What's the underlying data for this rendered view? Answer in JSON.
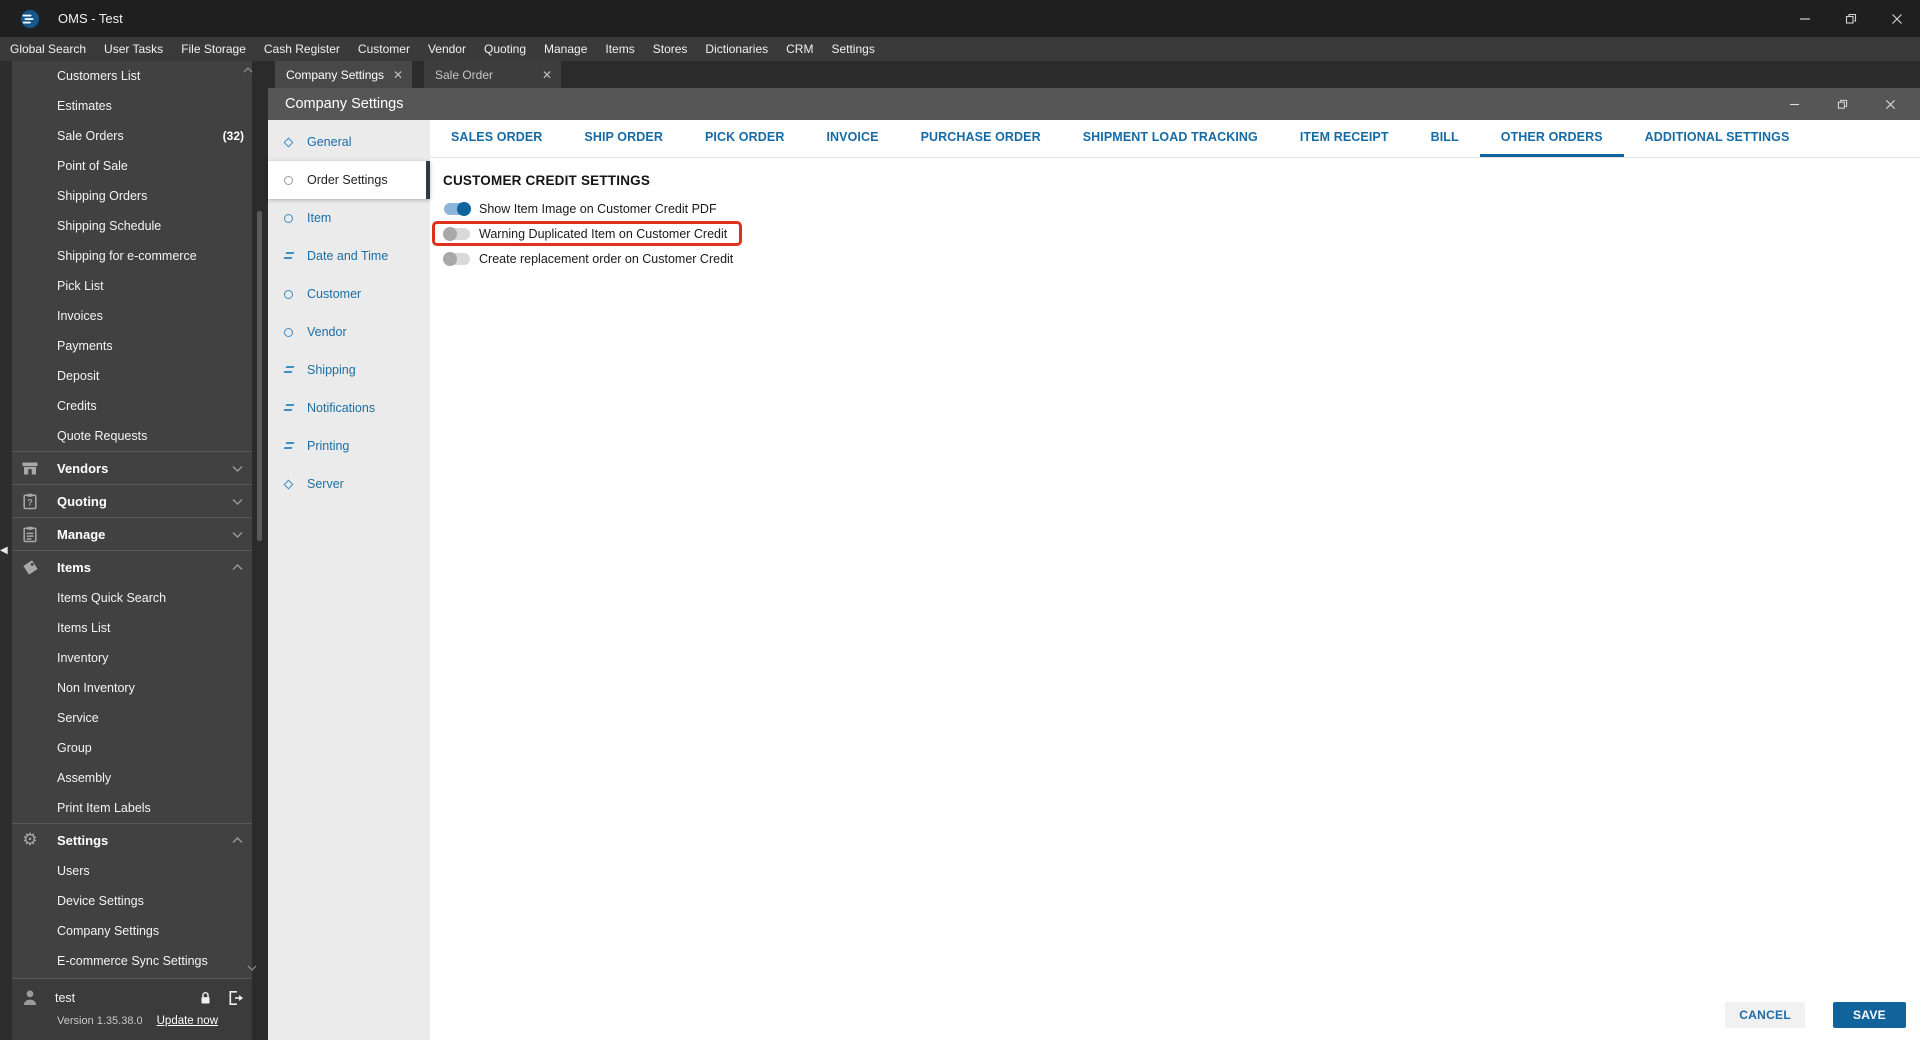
{
  "app": {
    "title": "OMS - Test"
  },
  "menubar": [
    "Global Search",
    "User Tasks",
    "File Storage",
    "Cash Register",
    "Customer",
    "Vendor",
    "Quoting",
    "Manage",
    "Items",
    "Stores",
    "Dictionaries",
    "CRM",
    "Settings"
  ],
  "sidebar": {
    "top_items": [
      {
        "label": "Customers List"
      },
      {
        "label": "Estimates"
      },
      {
        "label": "Sale Orders",
        "badge": "(32)"
      },
      {
        "label": "Point of Sale"
      },
      {
        "label": "Shipping Orders"
      },
      {
        "label": "Shipping Schedule"
      },
      {
        "label": "Shipping for e-commerce"
      },
      {
        "label": "Pick List"
      },
      {
        "label": "Invoices"
      },
      {
        "label": "Payments"
      },
      {
        "label": "Deposit"
      },
      {
        "label": "Credits"
      },
      {
        "label": "Quote Requests"
      }
    ],
    "groups": [
      {
        "label": "Vendors",
        "icon": "storefront-icon",
        "state": "collapsed"
      },
      {
        "label": "Quoting",
        "icon": "clipboard-question-icon",
        "state": "collapsed"
      },
      {
        "label": "Manage",
        "icon": "clipboard-icon",
        "state": "collapsed"
      }
    ],
    "items_group": {
      "label": "Items",
      "icon": "tag-icon",
      "state": "expanded",
      "children": [
        "Items Quick Search",
        "Items List",
        "Inventory",
        "Non Inventory",
        "Service",
        "Group",
        "Assembly",
        "Print Item Labels"
      ]
    },
    "settings_group": {
      "label": "Settings",
      "icon": "gear-icon",
      "state": "expanded",
      "children": [
        "Users",
        "Device Settings",
        "Company Settings",
        "E-commerce Sync Settings"
      ]
    },
    "user": {
      "name": "test"
    },
    "version": "Version 1.35.38.0",
    "update_link": "Update now"
  },
  "doc_tabs": [
    {
      "label": "Company Settings",
      "active": true
    },
    {
      "label": "Sale Order",
      "active": false
    }
  ],
  "settings_window": {
    "title": "Company Settings",
    "categories": [
      {
        "label": "General",
        "icon": "diamond"
      },
      {
        "label": "Order Settings",
        "icon": "circle",
        "selected": true
      },
      {
        "label": "Item",
        "icon": "circle"
      },
      {
        "label": "Date and Time",
        "icon": "lines"
      },
      {
        "label": "Customer",
        "icon": "circle"
      },
      {
        "label": "Vendor",
        "icon": "circle"
      },
      {
        "label": "Shipping",
        "icon": "lines"
      },
      {
        "label": "Notifications",
        "icon": "lines"
      },
      {
        "label": "Printing",
        "icon": "lines"
      },
      {
        "label": "Server",
        "icon": "diamond"
      }
    ],
    "tabs": [
      {
        "label": "SALES ORDER"
      },
      {
        "label": "SHIP ORDER"
      },
      {
        "label": "PICK ORDER"
      },
      {
        "label": "INVOICE"
      },
      {
        "label": "PURCHASE ORDER"
      },
      {
        "label": "SHIPMENT LOAD TRACKING"
      },
      {
        "label": "ITEM RECEIPT"
      },
      {
        "label": "BILL"
      },
      {
        "label": "OTHER ORDERS",
        "active": true
      },
      {
        "label": "ADDITIONAL SETTINGS"
      }
    ],
    "section_title": "CUSTOMER CREDIT SETTINGS",
    "toggles": [
      {
        "label": "Show Item Image on Customer Credit PDF",
        "on": true,
        "highlighted": false
      },
      {
        "label": "Warning Duplicated Item on Customer Credit",
        "on": false,
        "highlighted": true
      },
      {
        "label": "Create replacement order on Customer Credit",
        "on": false,
        "highlighted": false
      }
    ],
    "footer": {
      "cancel_label": "CANCEL",
      "save_label": "SAVE"
    }
  },
  "colors": {
    "accent_blue": "#176ba5",
    "tab_underline": "#0f639e",
    "toggle_on_track": "#8ab4da",
    "toggle_on_thumb": "#0e639c",
    "highlight_red": "#e0301e",
    "save_button_bg": "#11639c",
    "sidebar_bg": "#414141",
    "titlebar_bg": "#1f1f1f"
  }
}
